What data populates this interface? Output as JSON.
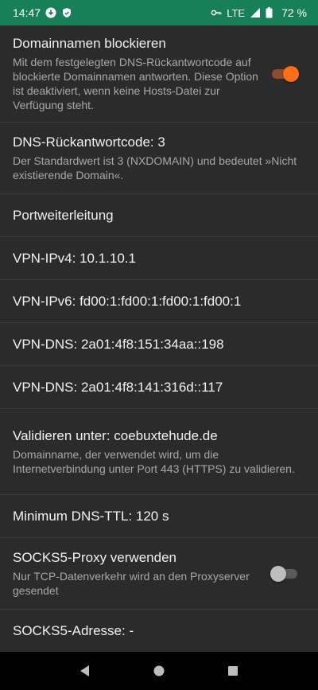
{
  "status_bar": {
    "time": "14:47",
    "network": "LTE",
    "battery": "72 %"
  },
  "settings": {
    "block_domains": {
      "title": "Domainnamen blockieren",
      "summary": "Mit dem festgelegten DNS-Rückantwortcode auf blockierte Domainnamen antworten. Diese Option ist deaktiviert, wenn keine Hosts-Datei zur Verfügung steht.",
      "enabled": true
    },
    "dns_code": {
      "title": "DNS-Rückantwortcode: 3",
      "summary": "Der Standardwert ist 3 (NXDOMAIN) und bedeutet »Nicht existierende Domain«."
    },
    "port_forwarding": {
      "title": "Portweiterleitung"
    },
    "vpn_ipv4": {
      "title": "VPN-IPv4: 10.1.10.1"
    },
    "vpn_ipv6": {
      "title": "VPN-IPv6: fd00:1:fd00:1:fd00:1:fd00:1"
    },
    "vpn_dns_1": {
      "title": "VPN-DNS: 2a01:4f8:151:34aa::198"
    },
    "vpn_dns_2": {
      "title": "VPN-DNS: 2a01:4f8:141:316d::117"
    },
    "validate": {
      "title": "Validieren unter: coebuxtehude.de",
      "summary": "Domainname, der verwendet wird, um die Internetverbindung unter Port 443 (HTTPS) zu validieren."
    },
    "min_ttl": {
      "title": "Minimum DNS-TTL: 120 s"
    },
    "socks5": {
      "title": "SOCKS5-Proxy verwenden",
      "summary": "Nur TCP-Datenverkehr wird an den Proxyserver gesendet",
      "enabled": false
    },
    "socks5_address": {
      "title": "SOCKS5-Adresse: -"
    }
  },
  "colors": {
    "status_bar": "#17805a",
    "background": "#2b2b2b",
    "accent": "#ff6d1a"
  }
}
